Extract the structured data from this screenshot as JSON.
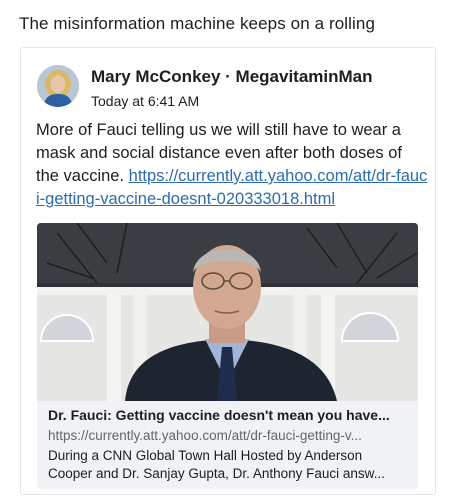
{
  "caption": "The misinformation machine keeps on a rolling",
  "post": {
    "author": "Mary McConkey",
    "separator": " · ",
    "group": "MegavitaminMan",
    "timestamp": "Today at 6:41 AM",
    "text": "More of Fauci telling us we will still have to wear a mask and social distance even after both doses of the vaccine. ",
    "link": "https://currently.att.yahoo.com/att/dr-fauci-getting-vaccine-doesnt-020333018.html"
  },
  "link_preview": {
    "title": "Dr. Fauci: Getting vaccine doesn't mean you have...",
    "url": "https://currently.att.yahoo.com/att/dr-fauci-getting-v...",
    "description_line1": "During a CNN Global Town Hall Hosted by Anderson",
    "description_line2": "Cooper and Dr. Sanjay Gupta, Dr. Anthony Fauci answ..."
  },
  "colors": {
    "link": "#2b6cb0",
    "preview_bg": "#f0f2f5",
    "muted_text": "#606770",
    "suit": "#1e2430",
    "tie": "#1f2c4d",
    "shirt": "#9fb6d8"
  }
}
